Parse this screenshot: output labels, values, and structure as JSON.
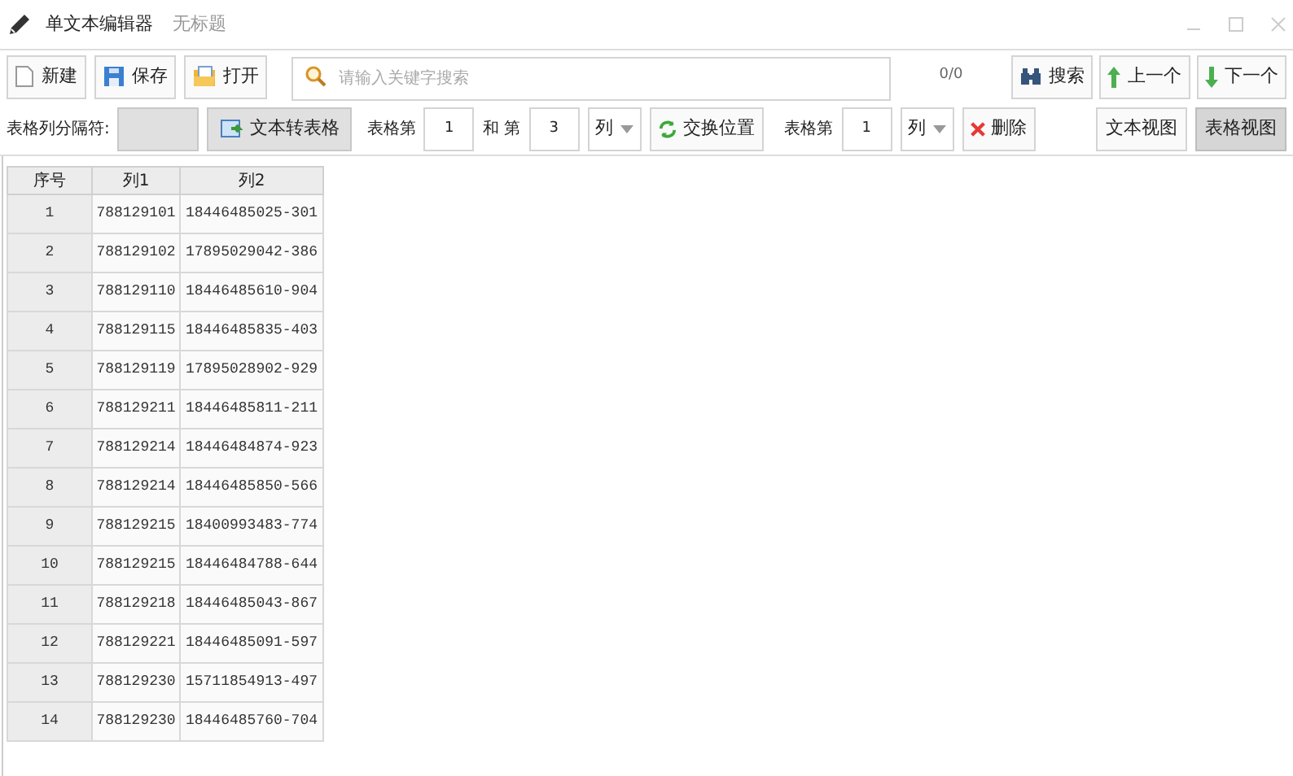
{
  "window": {
    "title": "单文本编辑器",
    "subtitle": "无标题"
  },
  "toolbar": {
    "buttons": [
      {
        "label": "新建",
        "kind": "new"
      },
      {
        "label": "保存",
        "kind": "save"
      },
      {
        "label": "打开",
        "kind": "open"
      }
    ],
    "search": {
      "placeholder": "请输入关键字搜索"
    },
    "count": "0/0",
    "nav": [
      {
        "label": "搜索",
        "kind": "search"
      },
      {
        "label": "上一个",
        "kind": "up"
      },
      {
        "label": "下一个",
        "kind": "down"
      }
    ]
  },
  "options": {
    "separator_label": "表格列分隔符:",
    "convert": "文本转表格",
    "swap_prefix": "表格第",
    "swap_a": "1",
    "swap_and": "和 第",
    "swap_b": "3",
    "swap_unit": "列",
    "swap": "交换位置",
    "delete_prefix": "表格第",
    "delete_col": "1",
    "delete_unit": "列",
    "delete": "删除",
    "views": [
      {
        "label": "文本视图",
        "selected": false
      },
      {
        "label": "表格视图",
        "selected": true
      }
    ]
  },
  "table": {
    "columns": [
      "序号",
      "列1",
      "列2"
    ],
    "rows": [
      [
        "1",
        "788129101",
        "18446485025-301"
      ],
      [
        "2",
        "788129102",
        "17895029042-386"
      ],
      [
        "3",
        "788129110",
        "18446485610-904"
      ],
      [
        "4",
        "788129115",
        "18446485835-403"
      ],
      [
        "5",
        "788129119",
        "17895028902-929"
      ],
      [
        "6",
        "788129211",
        "18446485811-211"
      ],
      [
        "7",
        "788129214",
        "18446484874-923"
      ],
      [
        "8",
        "788129214",
        "18446485850-566"
      ],
      [
        "9",
        "788129215",
        "18400993483-774"
      ],
      [
        "10",
        "788129215",
        "18446484788-644"
      ],
      [
        "11",
        "788129218",
        "18446485043-867"
      ],
      [
        "12",
        "788129221",
        "18446485091-597"
      ],
      [
        "13",
        "788129230",
        "15711854913-497"
      ],
      [
        "14",
        "788129230",
        "18446485760-704"
      ]
    ]
  }
}
